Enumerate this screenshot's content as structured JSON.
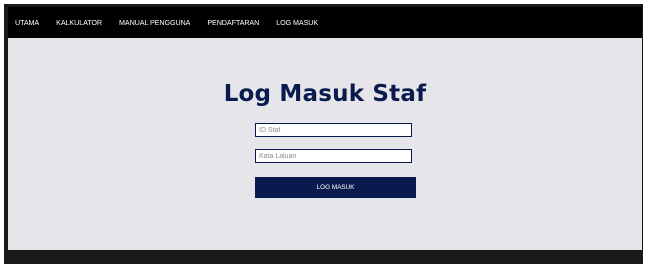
{
  "nav": {
    "items": [
      {
        "label": "UTAMA"
      },
      {
        "label": "KALKULATOR"
      },
      {
        "label": "MANUAL PENGGUNA"
      },
      {
        "label": "PENDAFTARAN"
      },
      {
        "label": "LOG MASUK"
      }
    ]
  },
  "login": {
    "title": "Log Masuk Staf",
    "id_placeholder": "ID Staf",
    "id_value": "",
    "password_placeholder": "Kata Laluan",
    "password_value": "",
    "submit_label": "LOG MASUK"
  },
  "colors": {
    "nav_background": "#000000",
    "content_background": "#e6e6ea",
    "accent": "#0b1a4e"
  }
}
